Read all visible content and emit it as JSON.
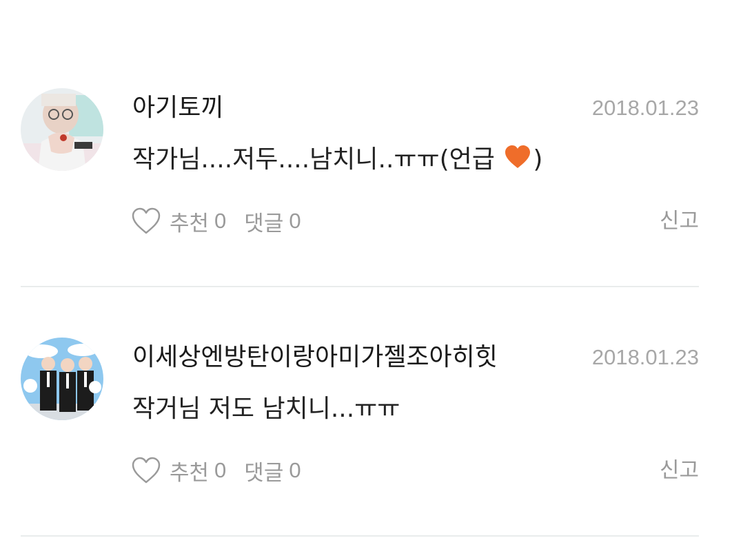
{
  "comments": [
    {
      "username": "아기토끼",
      "date": "2018.01.23",
      "text_before": "작가님....저두....남치니..ㅠㅠ(언급 ",
      "text_after": ")",
      "like_label": "추천",
      "like_count": "0",
      "reply_label": "댓글",
      "reply_count": "0",
      "report_label": "신고"
    },
    {
      "username": "이세상엔방탄이랑아미가젤조아히힛",
      "date": "2018.01.23",
      "text": "작거님 저도 남치니...ㅠㅠ",
      "like_label": "추천",
      "like_count": "0",
      "reply_label": "댓글",
      "reply_count": "0",
      "report_label": "신고"
    }
  ],
  "colors": {
    "accent_heart": "#ef6d2a",
    "muted_text": "#9a9a9a",
    "date_text": "#a7a7a7",
    "divider": "#e9ecec"
  },
  "icons": {
    "like": "heart-outline-icon",
    "emoji": "orange-heart-emoji"
  }
}
